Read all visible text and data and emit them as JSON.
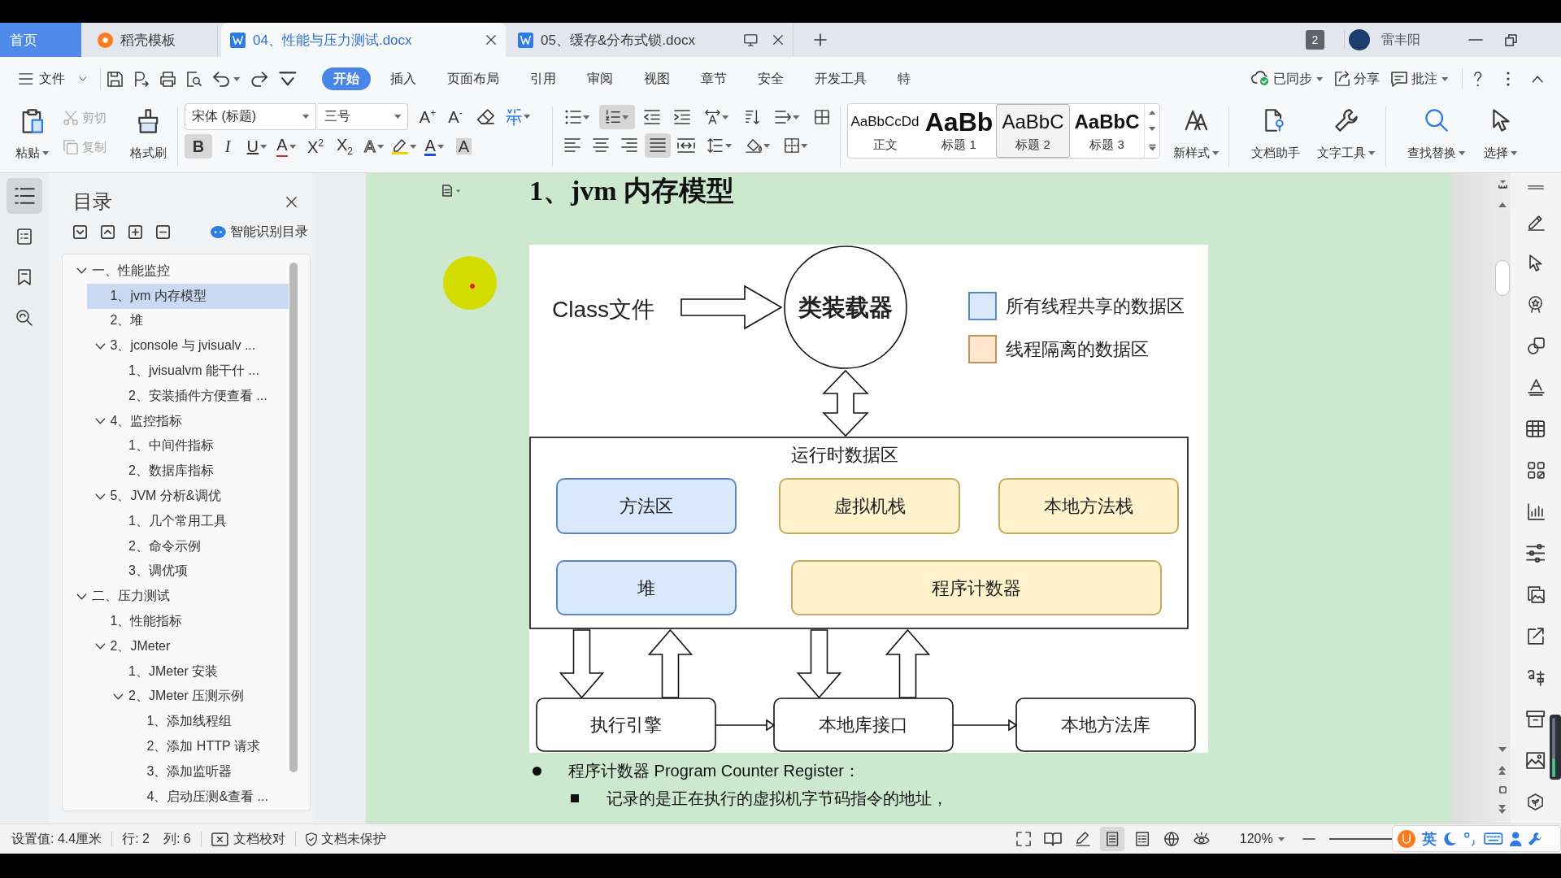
{
  "tab_bar": {
    "tabs": [
      {
        "kind": "home",
        "label": "首页",
        "selected": false,
        "hovered": false
      },
      {
        "kind": "template",
        "label": "稻壳模板",
        "selected": false,
        "hovered": false
      },
      {
        "kind": "document",
        "label": "04、性能与压力测试.docx",
        "selected": true,
        "hovered": false
      },
      {
        "kind": "document",
        "label": "05、缓存&分布式锁.docx",
        "selected": false,
        "hovered": true
      }
    ],
    "badge": "2",
    "user_name": "雷丰阳"
  },
  "menu_bar": {
    "file_label": "文件",
    "tabs": [
      {
        "label": "开始",
        "selected": true
      },
      {
        "label": "插入",
        "selected": false
      },
      {
        "label": "页面布局",
        "selected": false
      },
      {
        "label": "引用",
        "selected": false
      },
      {
        "label": "审阅",
        "selected": false
      },
      {
        "label": "视图",
        "selected": false
      },
      {
        "label": "章节",
        "selected": false
      },
      {
        "label": "安全",
        "selected": false
      },
      {
        "label": "开发工具",
        "selected": false
      },
      {
        "label": "特",
        "selected": false
      }
    ],
    "actions": [
      {
        "kind": "sync",
        "label": "已同步"
      },
      {
        "kind": "share",
        "label": "分享"
      },
      {
        "kind": "comment",
        "label": "批注"
      }
    ]
  },
  "ribbon": {
    "clipboard": [
      {
        "kind": "paste",
        "label": "粘贴",
        "disabled": false
      },
      {
        "kind": "cut",
        "label": "剪切",
        "disabled": true
      },
      {
        "kind": "copy",
        "label": "复制",
        "disabled": true
      },
      {
        "kind": "painter",
        "label": "格式刷",
        "disabled": false
      }
    ],
    "font_name": "宋体 (标题)",
    "font_size": "三号",
    "size_buttons": [
      "A$^{+}$",
      "A$^{-}$"
    ],
    "format_buttons": [
      {
        "kind": "bold",
        "glyph": "B",
        "pressed": true
      },
      {
        "kind": "italic",
        "glyph": "I",
        "pressed": false
      },
      {
        "kind": "underline",
        "glyph": "U",
        "pressed": false
      },
      {
        "kind": "strike",
        "glyph": "A",
        "pressed": false
      },
      {
        "kind": "superscript",
        "glyph": "X$^{2}$",
        "pressed": false
      },
      {
        "kind": "subscript",
        "glyph": "X$_{2}$",
        "pressed": false
      },
      {
        "kind": "effect",
        "glyph": "A",
        "pressed": false
      },
      {
        "kind": "highlight",
        "pressed": false
      },
      {
        "kind": "color",
        "glyph": "A",
        "pressed": false
      },
      {
        "kind": "shading",
        "glyph": "A",
        "pressed": false
      }
    ],
    "paragraph_rows": [
      [
        {
          "kind": "bullets",
          "pressed": false
        },
        {
          "kind": "numbering",
          "pressed": true
        },
        {
          "kind": "outdent",
          "pressed": false
        },
        {
          "kind": "indent",
          "pressed": false
        },
        {
          "kind": "text_direction",
          "pressed": false
        },
        {
          "kind": "sort",
          "pressed": false
        },
        {
          "kind": "spacing",
          "pressed": false
        },
        {
          "kind": "marks",
          "pressed": false
        }
      ],
      [
        {
          "kind": "align_left",
          "pressed": false
        },
        {
          "kind": "align_center",
          "pressed": false
        },
        {
          "kind": "align_right",
          "pressed": false
        },
        {
          "kind": "justify",
          "pressed": true
        },
        {
          "kind": "distribute",
          "pressed": false
        },
        {
          "kind": "line_spacing",
          "pressed": false
        },
        {
          "kind": "shading",
          "pressed": false
        },
        {
          "kind": "borders",
          "pressed": false
        }
      ]
    ],
    "styles": [
      {
        "preview": "AaBbCcDd",
        "label": "正文",
        "selected": false
      },
      {
        "preview": "AaBb",
        "label": "标题 1",
        "selected": false
      },
      {
        "preview": "AaBbC",
        "label": "标题 2",
        "selected": true
      },
      {
        "preview": "AaBbC",
        "label": "标题 3",
        "selected": false
      }
    ],
    "tools": [
      {
        "kind": "new_style",
        "label": "新样式"
      },
      {
        "kind": "assistant",
        "label": "文档助手"
      },
      {
        "kind": "text_tools",
        "label": "文字工具"
      },
      {
        "kind": "find",
        "label": "查找替换"
      },
      {
        "kind": "select",
        "label": "选择"
      }
    ]
  },
  "navigation": {
    "rail": [
      {
        "kind": "outline",
        "selected": true
      },
      {
        "kind": "pages",
        "selected": false
      },
      {
        "kind": "bookmarks",
        "selected": false
      },
      {
        "kind": "find",
        "selected": false
      }
    ],
    "title": "目录",
    "smart_label": "智能识别目录",
    "items": [
      {
        "label": "一、性能监控",
        "selected": false,
        "expanded": true,
        "children": [
          {
            "label": "1、jvm 内存模型",
            "selected": true
          },
          {
            "label": "2、堆",
            "selected": false
          },
          {
            "label": "3、jconsole 与 jvisualv ...",
            "selected": false,
            "expanded": true,
            "children": [
              {
                "label": "1、jvisualvm 能干什 ...",
                "selected": false
              },
              {
                "label": "2、安装插件方便查看 ...",
                "selected": false
              }
            ]
          },
          {
            "label": "4、监控指标",
            "selected": false,
            "expanded": true,
            "children": [
              {
                "label": "1、中间件指标",
                "selected": false
              },
              {
                "label": "2、数据库指标",
                "selected": false
              }
            ]
          },
          {
            "label": "5、JVM 分析&调优",
            "selected": false,
            "expanded": true,
            "children": [
              {
                "label": "1、几个常用工具",
                "selected": false
              },
              {
                "label": "2、命令示例",
                "selected": false
              },
              {
                "label": "3、调优项",
                "selected": false
              }
            ]
          }
        ]
      },
      {
        "label": "二、压力测试",
        "selected": false,
        "expanded": true,
        "children": [
          {
            "label": "1、性能指标",
            "selected": false
          },
          {
            "label": "2、JMeter",
            "selected": false,
            "expanded": true,
            "children": [
              {
                "label": "1、JMeter 安装",
                "selected": false
              },
              {
                "label": "2、JMeter 压测示例",
                "selected": false,
                "expanded": true,
                "children": [
                  {
                    "label": "1、添加线程组",
                    "selected": false
                  },
                  {
                    "label": "2、添加 HTTP 请求",
                    "selected": false
                  },
                  {
                    "label": "3、添加监听器",
                    "selected": false
                  },
                  {
                    "label": "4、启动压测&查看 ...",
                    "selected": false
                  }
                ]
              }
            ]
          }
        ]
      }
    ]
  },
  "document": {
    "heading": "1、jvm 内存模型",
    "diagram": {
      "source_label": "Class文件",
      "loader_label": "类装载器",
      "legend": [
        {
          "label": "所有线程共享的数据区",
          "color": "#dae8fc"
        },
        {
          "label": "线程隔离的数据区",
          "color": "#ffe6cc"
        }
      ],
      "runtime_area": {
        "title": "运行时数据区",
        "regions": [
          {
            "label": "方法区",
            "color": "#dae8fc"
          },
          {
            "label": "虚拟机栈",
            "color": "#fff2cc"
          },
          {
            "label": "本地方法栈",
            "color": "#fff2cc"
          },
          {
            "label": "堆",
            "color": "#dae8fc"
          },
          {
            "label": "程序计数器",
            "color": "#fff2cc"
          }
        ]
      },
      "components": [
        "执行引擎",
        "本地库接口",
        "本地方法库"
      ]
    },
    "bullets": [
      {
        "text": "程序计数器 Program Counter Register：",
        "children": [
          {
            "text": "记录的是正在执行的虚拟机字节码指令的地址，"
          }
        ]
      }
    ]
  },
  "status_bar": {
    "groups": [
      [
        {
          "kind": "text",
          "label": "设置值: 4.4厘米"
        }
      ],
      [
        {
          "kind": "text",
          "label": "行: 2"
        },
        {
          "kind": "text",
          "label": "列: 6"
        }
      ],
      [
        {
          "kind": "proofread",
          "label": "文档校对"
        }
      ],
      [
        {
          "kind": "protection",
          "label": "文档未保护"
        }
      ]
    ],
    "view_modes": [
      {
        "kind": "fullscreen",
        "selected": false
      },
      {
        "kind": "reading",
        "selected": false
      },
      {
        "kind": "pen",
        "selected": false
      },
      {
        "kind": "page",
        "selected": true
      },
      {
        "kind": "outline",
        "selected": false
      },
      {
        "kind": "web",
        "selected": false
      },
      {
        "kind": "eye_care",
        "selected": false
      }
    ],
    "zoom": "120%"
  },
  "ime_toolbar": {
    "mode": "英"
  }
}
